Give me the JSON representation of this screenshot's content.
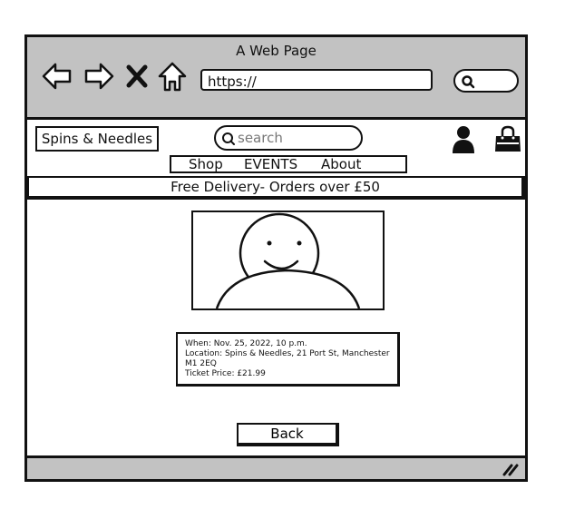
{
  "browser": {
    "title": "A Web Page",
    "url": "https://",
    "icons": [
      "back-arrow-icon",
      "forward-arrow-icon",
      "close-icon",
      "home-icon",
      "search-icon",
      "resize-grip-icon"
    ]
  },
  "header": {
    "logo": "Spins & Needles",
    "search_placeholder": "search",
    "icons": [
      "user-icon",
      "shopping-bag-icon"
    ]
  },
  "nav": {
    "items": [
      "Shop",
      "EVENTS",
      "About"
    ]
  },
  "banner": {
    "text": "Free Delivery- Orders over £50"
  },
  "event": {
    "image_icon": "smiley-face-placeholder-icon",
    "when": "When: Nov. 25, 2022, 10 p.m.",
    "location_line1": "Location: Spins & Needles, 21 Port St, Manchester",
    "location_line2": "M1 2EQ",
    "price": "Ticket Price: £21.99"
  },
  "actions": {
    "back_label": "Back"
  }
}
